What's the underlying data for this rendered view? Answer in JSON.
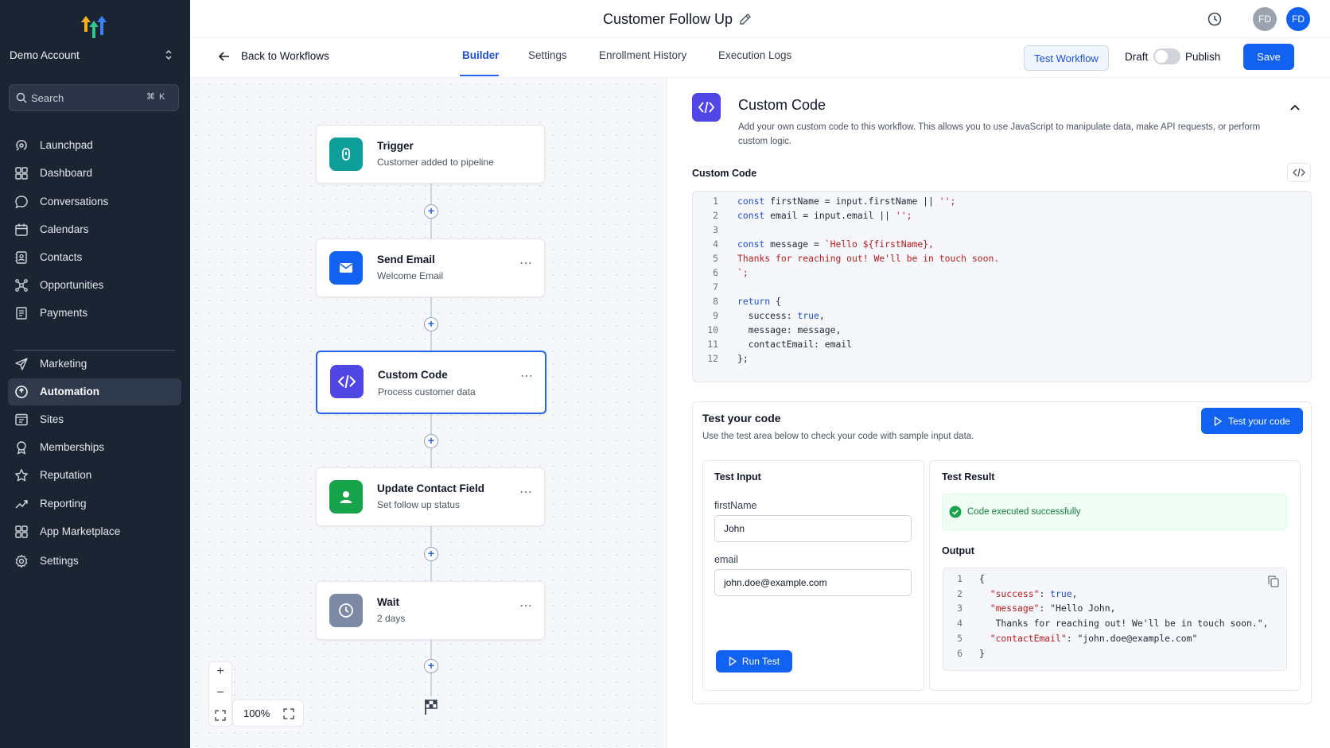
{
  "sidebar": {
    "account_name": "Demo Account",
    "search_placeholder": "Search",
    "search_shortcut": "⌘ K",
    "items": [
      {
        "label": "Launchpad",
        "icon": "launchpad-icon"
      },
      {
        "label": "Dashboard",
        "icon": "dashboard-icon"
      },
      {
        "label": "Conversations",
        "icon": "chat-icon"
      },
      {
        "label": "Calendars",
        "icon": "calendar-icon"
      },
      {
        "label": "Contacts",
        "icon": "contacts-icon"
      },
      {
        "label": "Opportunities",
        "icon": "opportunities-icon"
      },
      {
        "label": "Payments",
        "icon": "payments-icon"
      },
      {
        "label": "Marketing",
        "icon": "send-icon"
      },
      {
        "label": "Automation",
        "icon": "automation-icon",
        "active": true
      },
      {
        "label": "Sites",
        "icon": "sites-icon"
      },
      {
        "label": "Memberships",
        "icon": "memberships-icon"
      },
      {
        "label": "Reputation",
        "icon": "star-icon"
      },
      {
        "label": "Reporting",
        "icon": "reporting-icon"
      },
      {
        "label": "App Marketplace",
        "icon": "marketplace-icon"
      },
      {
        "label": "Settings",
        "icon": "gear-icon"
      }
    ]
  },
  "header": {
    "title": "Customer Follow Up",
    "avatars": [
      {
        "initials": "FD",
        "color": "#9ca3af"
      },
      {
        "initials": "FD",
        "color": "#1162f0"
      }
    ]
  },
  "subheader": {
    "back_label": "Back to Workflows",
    "tabs": [
      {
        "label": "Builder",
        "active": true
      },
      {
        "label": "Settings"
      },
      {
        "label": "Enrollment History"
      },
      {
        "label": "Execution Logs"
      }
    ],
    "test_workflow_label": "Test Workflow",
    "draft_label": "Draft",
    "publish_label": "Publish",
    "publish_on": false,
    "save_label": "Save"
  },
  "canvas": {
    "nodes": [
      {
        "title": "Trigger",
        "subtitle": "Customer added to pipeline",
        "icon": "trigger-icon",
        "color": "#0f9f9a"
      },
      {
        "title": "Send Email",
        "subtitle": "Welcome Email",
        "icon": "email-icon",
        "color": "#1162f0"
      },
      {
        "title": "Custom Code",
        "subtitle": "Process customer data",
        "icon": "code-icon",
        "color": "#4f46e5"
      },
      {
        "title": "Update Contact Field",
        "subtitle": "Set follow up status",
        "icon": "user-icon",
        "color": "#16a34a"
      },
      {
        "title": "Wait",
        "subtitle": "2 days",
        "icon": "clock-icon",
        "color": "#7c8aa5"
      }
    ],
    "zoom_level": "100%",
    "zoom_in": "+",
    "zoom_out": "−"
  },
  "panel": {
    "title": "Custom Code",
    "description_line1": "Add your own custom code to this workflow. This allows you to use JavaScript to manipulate data, make API requests, or perform",
    "description_line2": "custom logic.",
    "code_label": "Custom Code",
    "code_lines": [
      "const firstName = input.firstName || '';",
      "const email = input.email || '';",
      "",
      "const message = `Hello ${firstName},",
      "Thanks for reaching out! We'll be in touch soon.",
      "`;",
      "",
      "return {",
      "  success: true,",
      "  message: message,",
      "  contactEmail: email",
      "};"
    ],
    "test": {
      "title": "Test your code",
      "description": "Use the test area below to check your code with sample input data.",
      "test_button_label": "Test your code",
      "input_title": "Test Input",
      "first_name_label": "firstName",
      "first_name_value": "John",
      "email_label": "email",
      "email_value": "john.doe@example.com",
      "run_label": "Run Test",
      "result_title": "Test Result",
      "success_message": "Code executed successfully",
      "output_label": "Output",
      "output_lines": [
        "{",
        "  \"success\": true,",
        "  \"message\": \"Hello John,",
        "   Thanks for reaching out! We'll be in touch soon.\",",
        "  \"contactEmail\": \"john.doe@example.com\"",
        "}"
      ]
    }
  }
}
